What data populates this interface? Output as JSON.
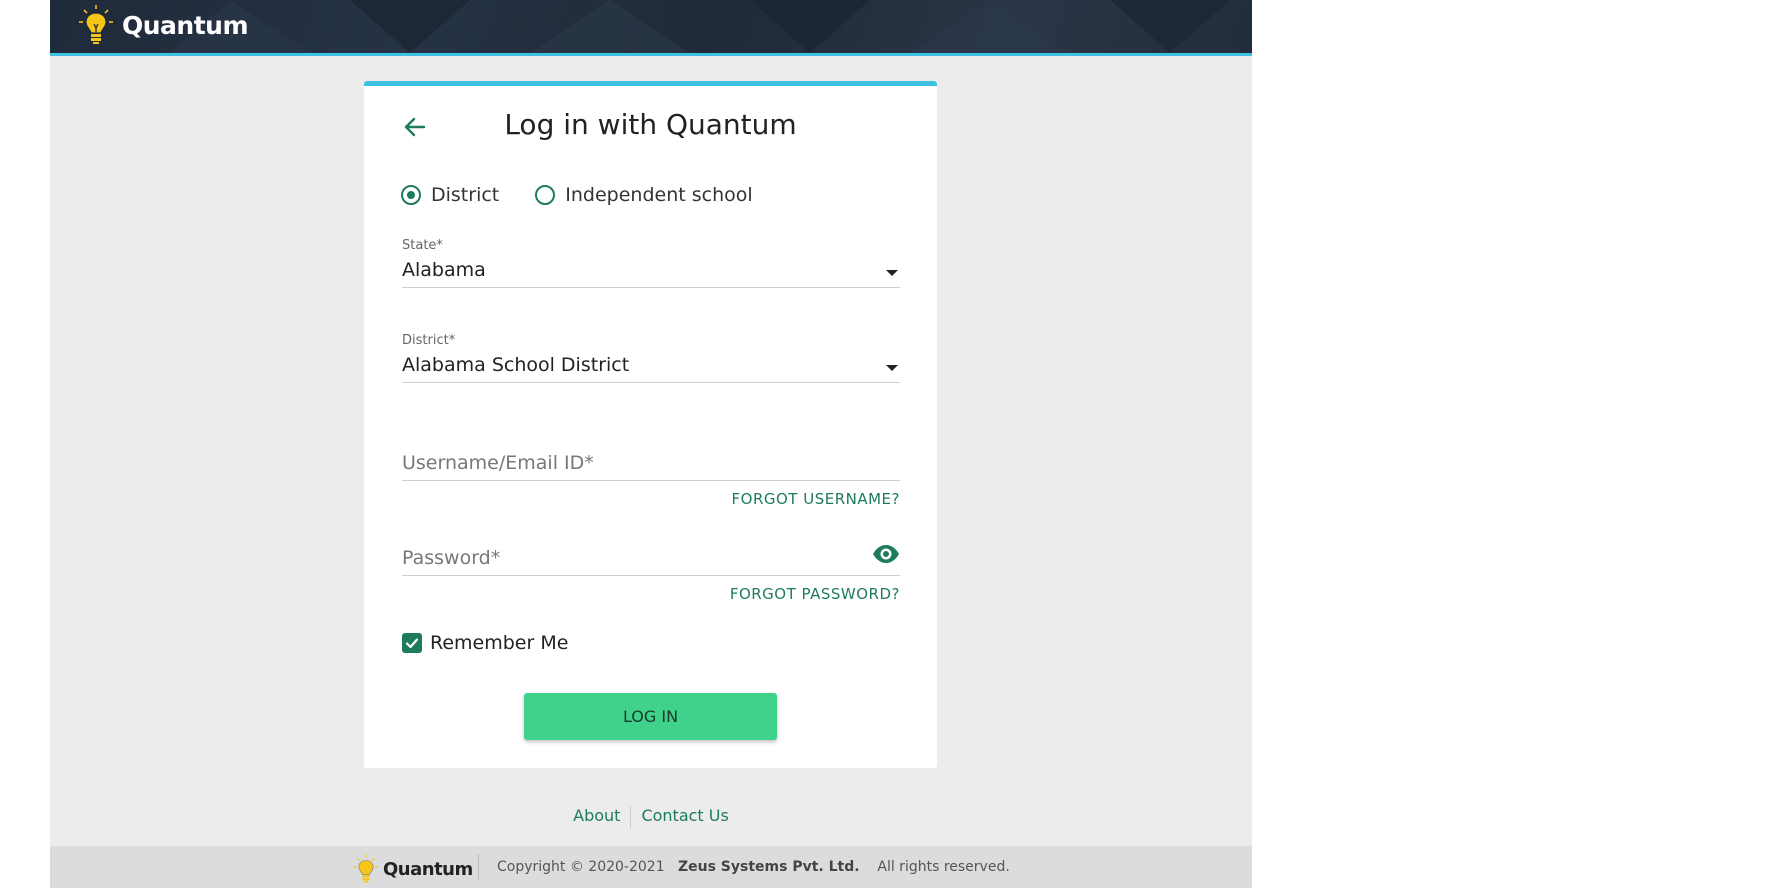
{
  "header": {
    "brand_name": "Quantum"
  },
  "login_card": {
    "title": "Log in with Quantum",
    "login_type_options": [
      {
        "label": "District",
        "selected": true
      },
      {
        "label": "Independent school",
        "selected": false
      }
    ],
    "state_field": {
      "label": "State*",
      "value": "Alabama"
    },
    "district_field": {
      "label": "District*",
      "value": "Alabama School District"
    },
    "username_field": {
      "placeholder": "Username/Email ID*",
      "value": ""
    },
    "forgot_username_label": "FORGOT USERNAME?",
    "password_field": {
      "placeholder": "Password*",
      "value": ""
    },
    "forgot_password_label": "FORGOT PASSWORD?",
    "remember_me": {
      "label": "Remember Me",
      "checked": true
    },
    "login_button_label": "LOG IN"
  },
  "bottom_links": {
    "about": "About",
    "contact": "Contact Us"
  },
  "footer": {
    "brand_name": "Quantum",
    "copyright_prefix": "Copyright © 2020-2021",
    "company": "Zeus Systems Pvt. Ltd.",
    "rights": "All rights reserved."
  },
  "colors": {
    "accent_green": "#1e7b5e",
    "button_green": "#40d18a",
    "top_accent": "#3ec1e3",
    "header_bg": "#1f2a3a"
  },
  "icons": {
    "logo": "lightbulb-icon",
    "back": "arrow-left-icon",
    "password_toggle": "eye-icon",
    "dropdown": "caret-down-icon",
    "checkbox": "check-icon"
  }
}
